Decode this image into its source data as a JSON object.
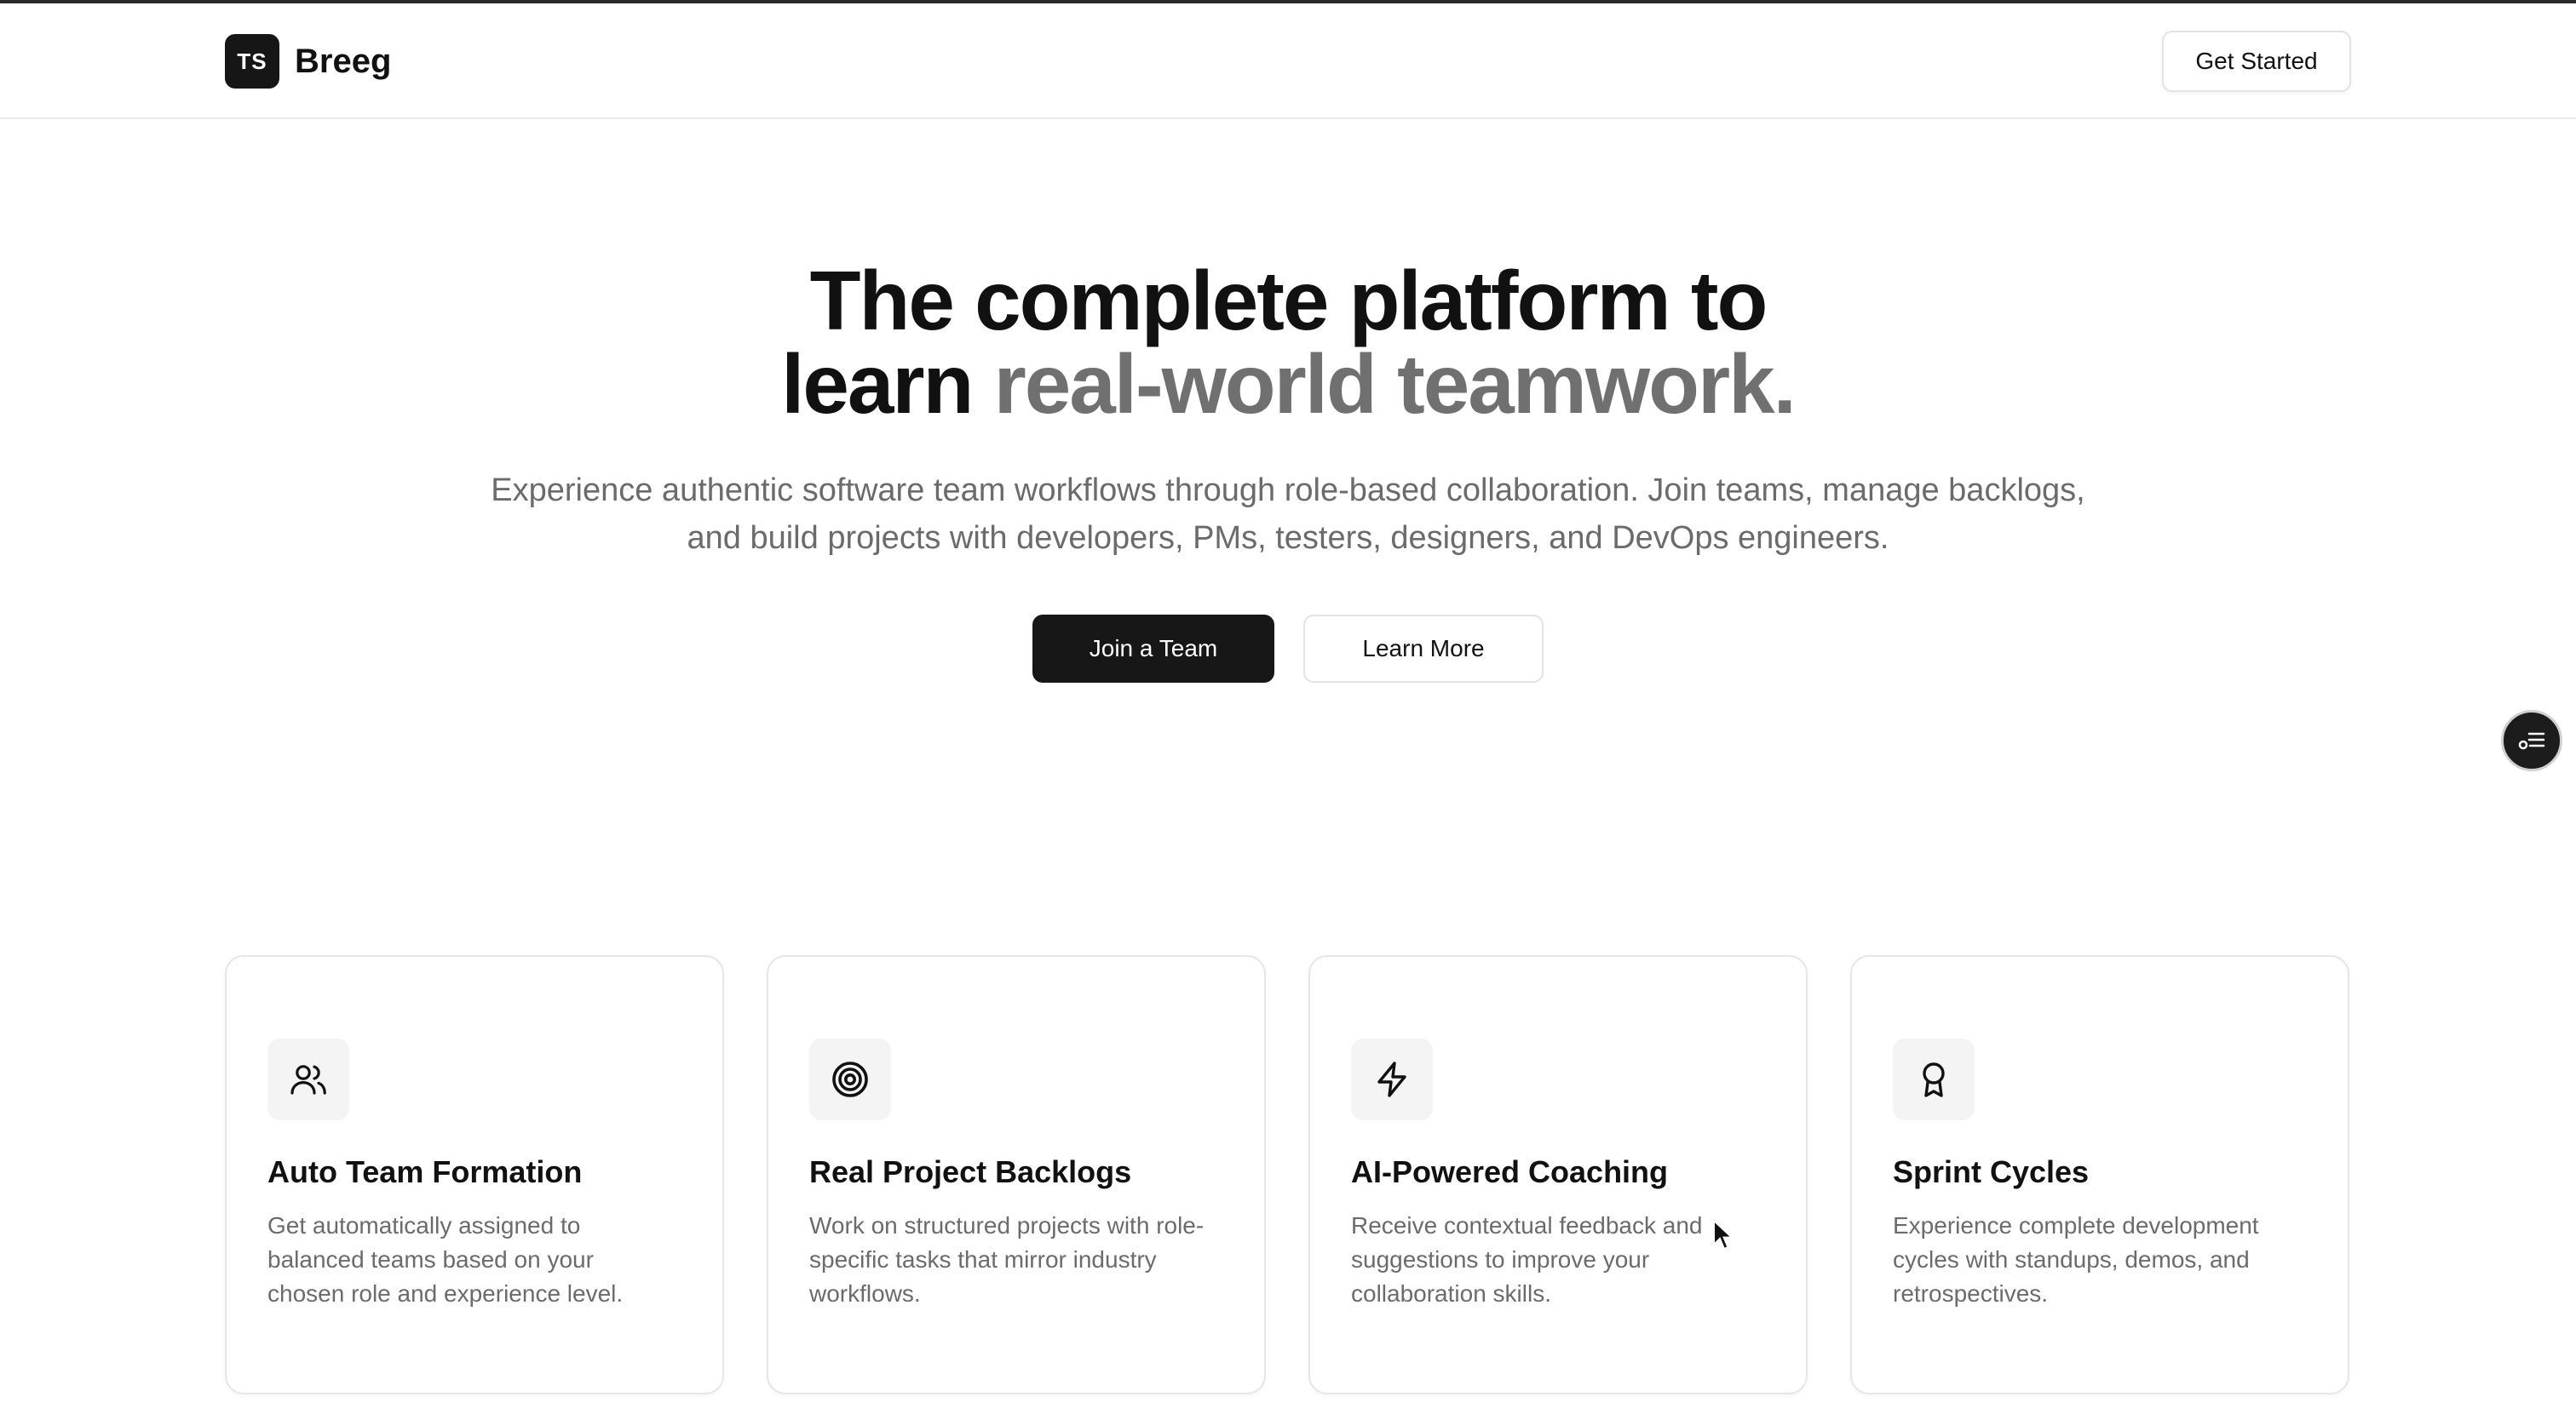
{
  "header": {
    "logo_text": "TS",
    "brand_name": "Breeg",
    "get_started_label": "Get Started"
  },
  "hero": {
    "title_line1": "The complete platform to",
    "title_line2_dark": "learn ",
    "title_line2_muted": "real-world teamwork.",
    "subtitle": "Experience authentic software team workflows through role-based collaboration. Join teams, manage backlogs, and build projects with developers, PMs, testers, designers, and DevOps engineers.",
    "primary_cta": "Join a Team",
    "secondary_cta": "Learn More"
  },
  "features": [
    {
      "icon": "users-icon",
      "title": "Auto Team Formation",
      "description": "Get automatically assigned to balanced teams based on your chosen role and experience level."
    },
    {
      "icon": "target-icon",
      "title": "Real Project Backlogs",
      "description": "Work on structured projects with role-specific tasks that mirror industry workflows."
    },
    {
      "icon": "lightning-icon",
      "title": "AI-Powered Coaching",
      "description": "Receive contextual feedback and suggestions to improve your collaboration skills."
    },
    {
      "icon": "award-icon",
      "title": "Sprint Cycles",
      "description": "Experience complete development cycles with standups, demos, and retrospectives."
    }
  ],
  "colors": {
    "primary": "#171717",
    "muted_text": "#707070",
    "border": "#e6e6e6"
  }
}
